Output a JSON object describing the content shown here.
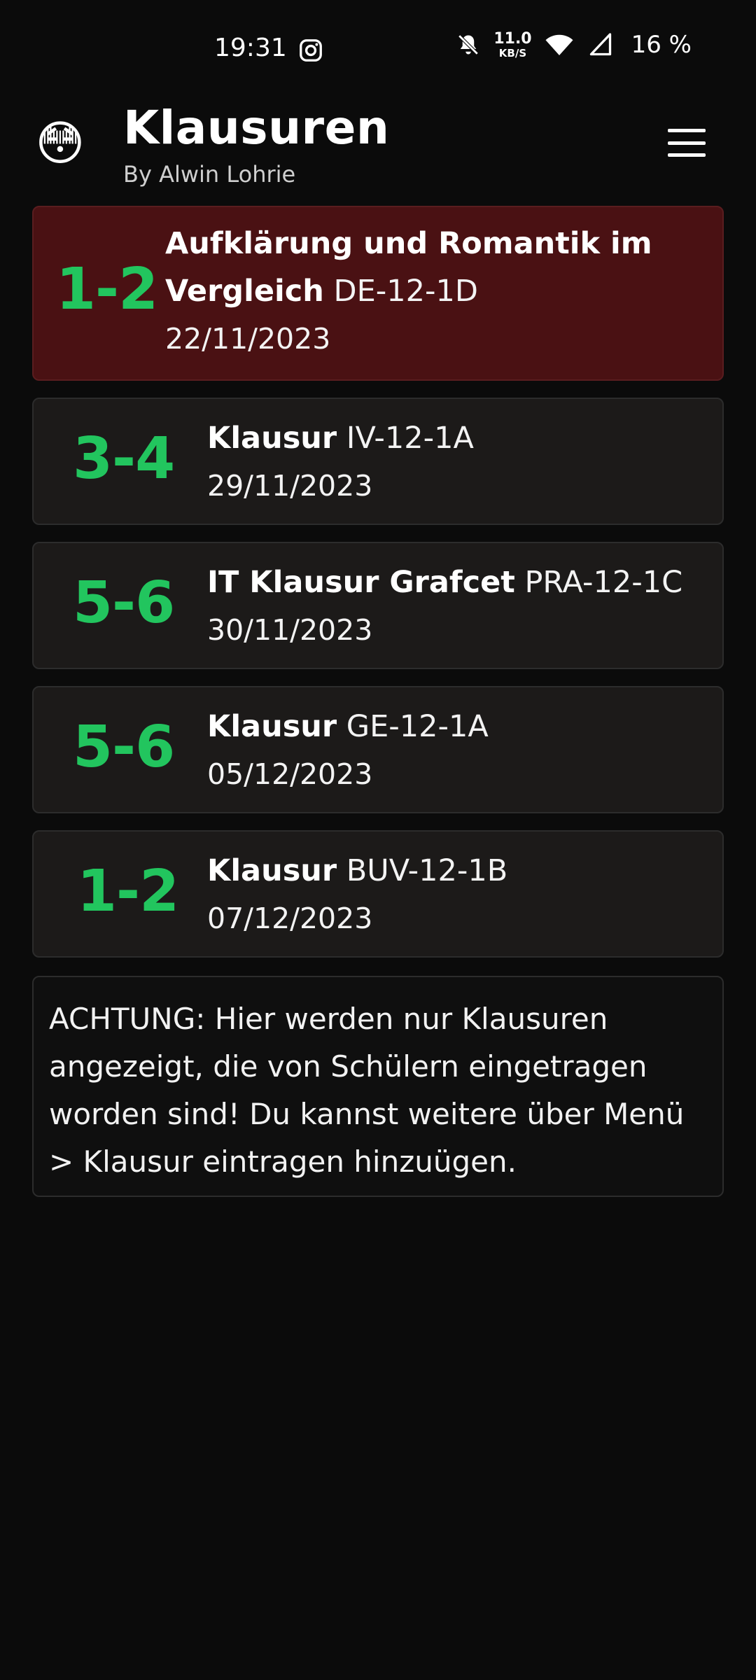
{
  "status_bar": {
    "time": "19:31",
    "speed_value": "11.0",
    "speed_unit": "KB/S",
    "battery": "16 %",
    "icons": [
      "instagram-icon",
      "bell-off-icon",
      "wifi-icon",
      "signal-icon"
    ]
  },
  "header": {
    "avatar_emoji": "😳",
    "title": "Klausuren",
    "subtitle": "By Alwin Lohrie",
    "menu_icon": "hamburger-menu-icon"
  },
  "exams": [
    {
      "periods": "1-2",
      "name": "Aufklärung und Romantik im Vergleich",
      "code": "DE-12-1D",
      "date": "22/11/2023",
      "highlighted": true
    },
    {
      "periods": "3-4",
      "name": "Klausur",
      "code": "IV-12-1A",
      "date": "29/11/2023",
      "highlighted": false
    },
    {
      "periods": "5-6",
      "name": "IT Klausur Grafcet",
      "code": "PRA-12-1C",
      "date": "30/11/2023",
      "highlighted": false
    },
    {
      "periods": "5-6",
      "name": "Klausur",
      "code": "GE-12-1A",
      "date": "05/12/2023",
      "highlighted": false
    },
    {
      "periods": "1-2",
      "name": "Klausur",
      "code": "BUV-12-1B",
      "date": "07/12/2023",
      "highlighted": false
    }
  ],
  "note": "ACHTUNG: Hier werden nur Klausuren angezeigt, die von Schülern eingetragen worden sind! Du kannst weitere über Menü > Klausur eintragen hinzuügen.",
  "colors": {
    "background": "#0b0b0b",
    "card": "#1c1a19",
    "highlight_card": "#4a1113",
    "score_green": "#22c55e"
  }
}
